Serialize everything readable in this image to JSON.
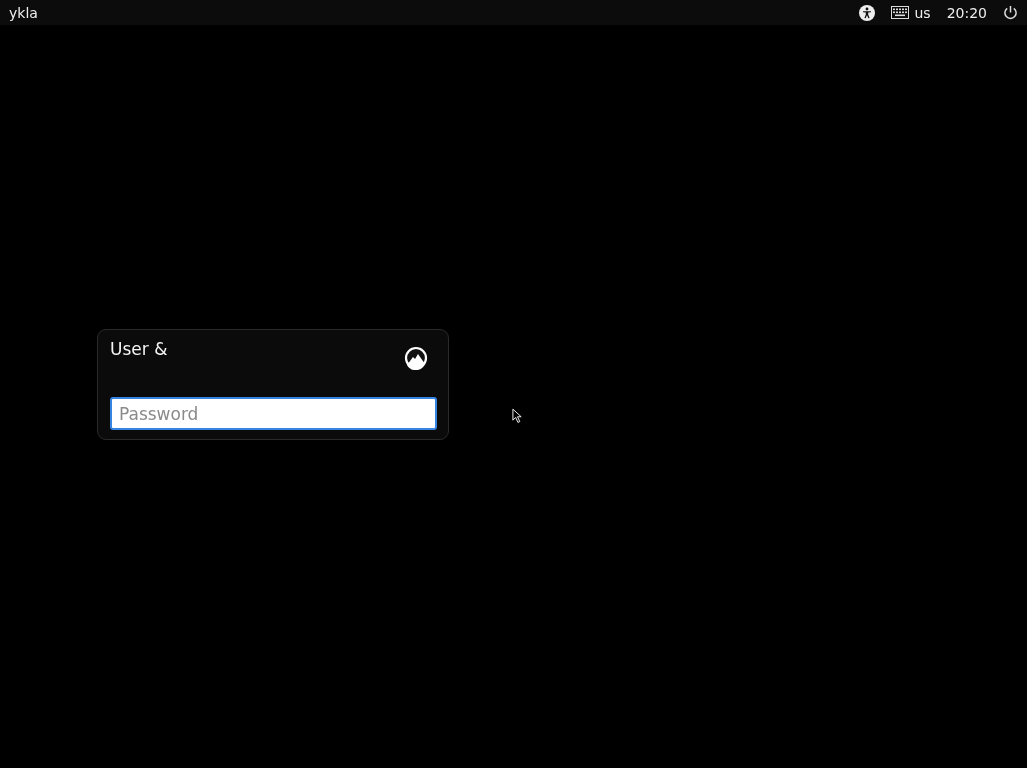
{
  "top_bar": {
    "hostname": "ykla",
    "keyboard_layout": "us",
    "clock": "20:20"
  },
  "login": {
    "user_label": "User &",
    "password": {
      "placeholder": "Password",
      "focused": true
    }
  }
}
